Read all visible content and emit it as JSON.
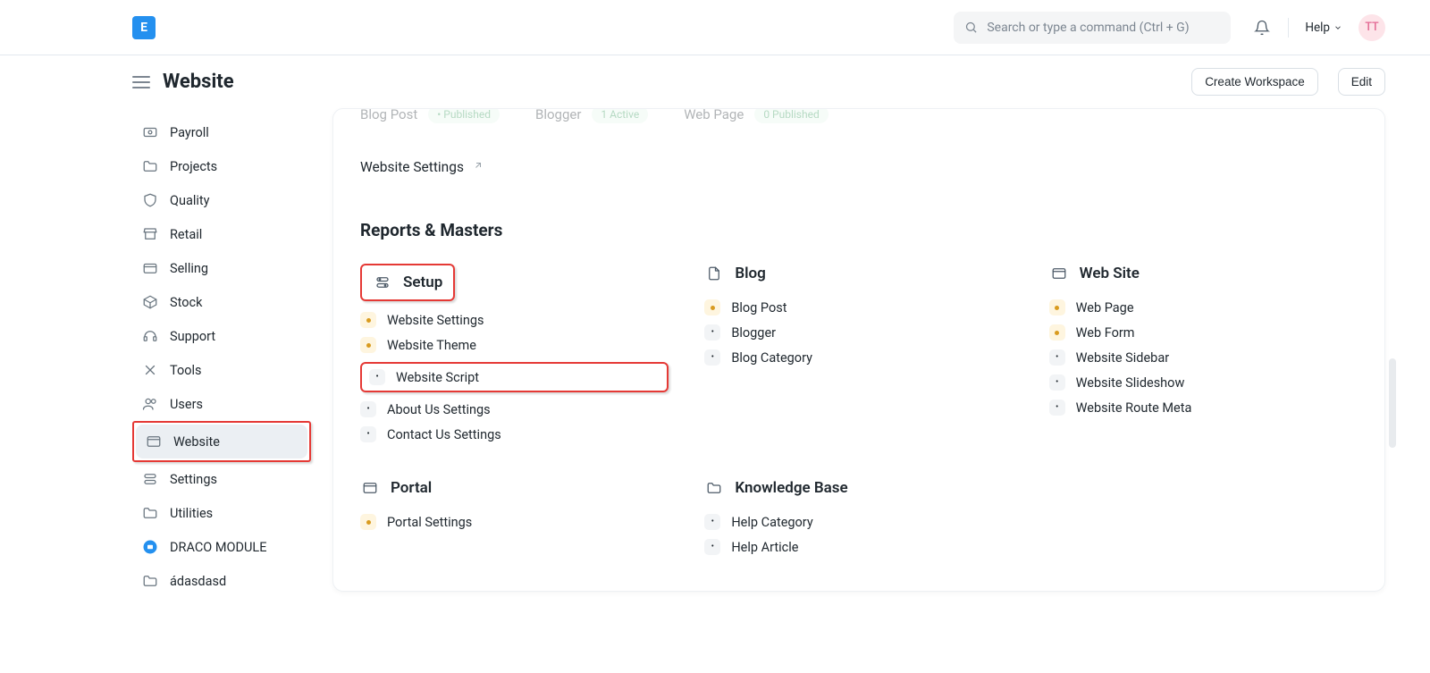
{
  "navbar": {
    "search_placeholder": "Search or type a command (Ctrl + G)",
    "help_label": "Help",
    "avatar": "TT"
  },
  "header": {
    "title": "Website",
    "create_btn": "Create Workspace",
    "edit_btn": "Edit"
  },
  "sidebar": {
    "items": [
      {
        "label": "Payroll",
        "icon": "payroll"
      },
      {
        "label": "Projects",
        "icon": "folder"
      },
      {
        "label": "Quality",
        "icon": "shield"
      },
      {
        "label": "Retail",
        "icon": "store"
      },
      {
        "label": "Selling",
        "icon": "card"
      },
      {
        "label": "Stock",
        "icon": "box"
      },
      {
        "label": "Support",
        "icon": "headset"
      },
      {
        "label": "Tools",
        "icon": "tools"
      },
      {
        "label": "Users",
        "icon": "users"
      },
      {
        "label": "Website",
        "icon": "browser",
        "active": true,
        "highlight": true
      },
      {
        "label": "Settings",
        "icon": "settings"
      },
      {
        "label": "Utilities",
        "icon": "folder"
      },
      {
        "label": "DRACO MODULE",
        "icon": "module"
      },
      {
        "label": "ádasdasd",
        "icon": "folder"
      }
    ]
  },
  "shortcuts": {
    "items": [
      {
        "label": "Blog Post",
        "status": "• Published"
      },
      {
        "label": "Blogger",
        "status": "1 Active"
      },
      {
        "label": "Web Page",
        "status": "0 Published"
      }
    ],
    "website_settings": "Website Settings"
  },
  "reports_title": "Reports & Masters",
  "groups": [
    {
      "title": "Setup",
      "icon": "setup",
      "highlight": true,
      "items": [
        {
          "label": "Website Settings",
          "ind": "yellow"
        },
        {
          "label": "Website Theme",
          "ind": "yellow"
        },
        {
          "label": "Website Script",
          "ind": "grey",
          "highlight": true
        },
        {
          "label": "About Us Settings",
          "ind": "grey"
        },
        {
          "label": "Contact Us Settings",
          "ind": "grey"
        }
      ]
    },
    {
      "title": "Blog",
      "icon": "doc",
      "items": [
        {
          "label": "Blog Post",
          "ind": "yellow"
        },
        {
          "label": "Blogger",
          "ind": "grey"
        },
        {
          "label": "Blog Category",
          "ind": "grey"
        }
      ]
    },
    {
      "title": "Web Site",
      "icon": "browser",
      "items": [
        {
          "label": "Web Page",
          "ind": "yellow"
        },
        {
          "label": "Web Form",
          "ind": "yellow"
        },
        {
          "label": "Website Sidebar",
          "ind": "grey"
        },
        {
          "label": "Website Slideshow",
          "ind": "grey"
        },
        {
          "label": "Website Route Meta",
          "ind": "grey"
        }
      ]
    },
    {
      "title": "Portal",
      "icon": "browser",
      "items": [
        {
          "label": "Portal Settings",
          "ind": "yellow"
        }
      ]
    },
    {
      "title": "Knowledge Base",
      "icon": "folder",
      "items": [
        {
          "label": "Help Category",
          "ind": "grey"
        },
        {
          "label": "Help Article",
          "ind": "grey"
        }
      ]
    }
  ]
}
